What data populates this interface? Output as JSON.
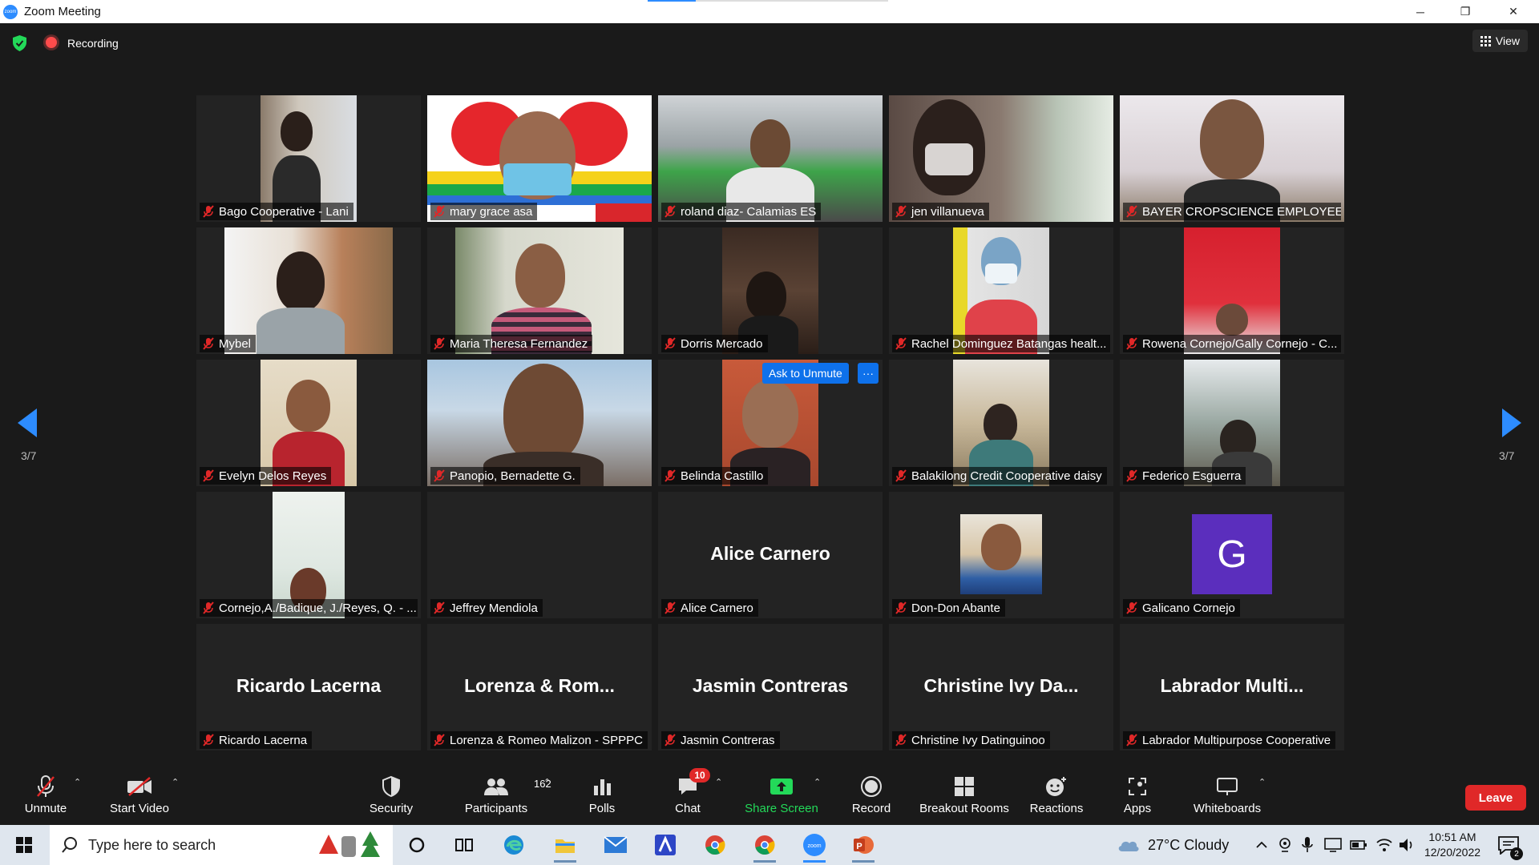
{
  "window": {
    "title": "Zoom Meeting",
    "minimize": "─",
    "maximize": "❐",
    "close": "✕"
  },
  "topbar": {
    "recording_label": "Recording",
    "view_label": "View"
  },
  "pager": {
    "left_label": "3/7",
    "right_label": "3/7"
  },
  "tiles": [
    {
      "name": "Bago Cooperative - Lani"
    },
    {
      "name": "mary grace asa"
    },
    {
      "name": "roland diaz- Calamias ES"
    },
    {
      "name": "jen villanueva"
    },
    {
      "name": "BAYER CROPSCIENCE EMPLOYEES..."
    },
    {
      "name": "Mybel"
    },
    {
      "name": "Maria Theresa Fernandez"
    },
    {
      "name": "Dorris Mercado"
    },
    {
      "name": "Rachel Dominguez Batangas healt..."
    },
    {
      "name": "Rowena Cornejo/Gally Cornejo - C..."
    },
    {
      "name": "Evelyn Delos Reyes"
    },
    {
      "name": "Panopio, Bernadette G."
    },
    {
      "name": "Belinda Castillo"
    },
    {
      "name": "Balakilong Credit Cooperative daisy"
    },
    {
      "name": "Federico Esguerra"
    },
    {
      "name": "Cornejo,A./Badique, J./Reyes, Q. - ..."
    },
    {
      "name": "Jeffrey Mendiola"
    },
    {
      "name": "Alice Carnero",
      "center": "Alice Carnero"
    },
    {
      "name": "Don-Don Abante"
    },
    {
      "name": "Galicano Cornejo",
      "avatar_letter": "G"
    },
    {
      "name": "Ricardo Lacerna",
      "center": "Ricardo Lacerna"
    },
    {
      "name": "Lorenza & Romeo Malizon - SPPPC",
      "center": "Lorenza & Rom..."
    },
    {
      "name": "Jasmin Contreras",
      "center": "Jasmin Contreras"
    },
    {
      "name": "Christine Ivy Datinguinoo",
      "center": "Christine Ivy Da..."
    },
    {
      "name": "Labrador Multipurpose Cooperative",
      "center": "Labrador Multi..."
    }
  ],
  "hover": {
    "ask_to_unmute": "Ask to Unmute",
    "more": "···"
  },
  "toolbar": {
    "unmute": "Unmute",
    "start_video": "Start Video",
    "security": "Security",
    "participants": "Participants",
    "participants_count": "162",
    "polls": "Polls",
    "chat": "Chat",
    "chat_badge": "10",
    "share_screen": "Share Screen",
    "record": "Record",
    "breakout_rooms": "Breakout Rooms",
    "reactions": "Reactions",
    "apps": "Apps",
    "whiteboards": "Whiteboards",
    "leave": "Leave",
    "caret": "⌃"
  },
  "taskbar": {
    "search_placeholder": "Type here to search",
    "weather": "27°C  Cloudy",
    "time": "10:51 AM",
    "date": "12/20/2022",
    "notification_count": "2"
  },
  "colors": {
    "accent": "#2d8cff",
    "leave": "#e02828",
    "share": "#23d959",
    "muted": "#e02828"
  }
}
